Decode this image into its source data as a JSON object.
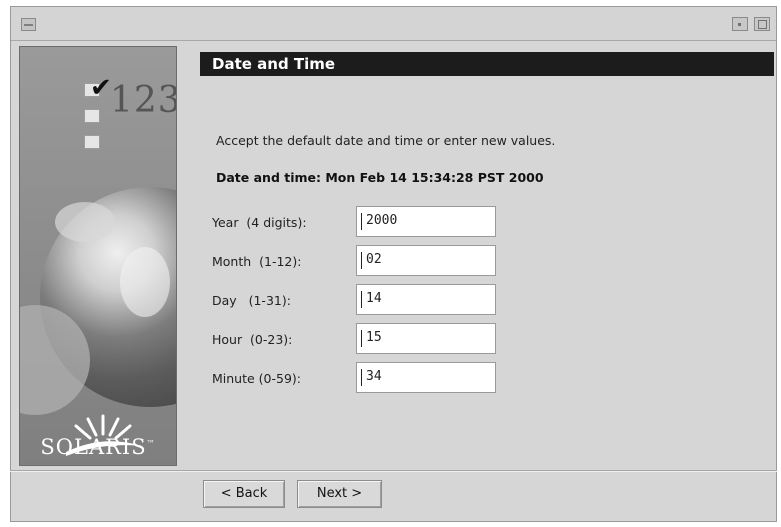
{
  "window": {},
  "brand": {
    "badge_number": "123",
    "checkmark": "✔",
    "logo_text": "SOLARIS",
    "trademark": "™"
  },
  "header": {
    "title": "Date and Time"
  },
  "body": {
    "instruction": "Accept the default date and time or enter new values.",
    "current_datetime": "Date and time: Mon Feb 14 15:34:28 PST 2000"
  },
  "fields": [
    {
      "label": "Year  (4 digits):",
      "value": "2000"
    },
    {
      "label": "Month  (1-12):",
      "value": "02"
    },
    {
      "label": "Day   (1-31):",
      "value": "14"
    },
    {
      "label": "Hour  (0-23):",
      "value": "15"
    },
    {
      "label": "Minute (0-59):",
      "value": "34"
    }
  ],
  "buttons": {
    "back": "< Back",
    "next": "Next >"
  },
  "colors": {
    "header_bg": "#1c1c1c",
    "window_bg": "#d6d6d6"
  }
}
